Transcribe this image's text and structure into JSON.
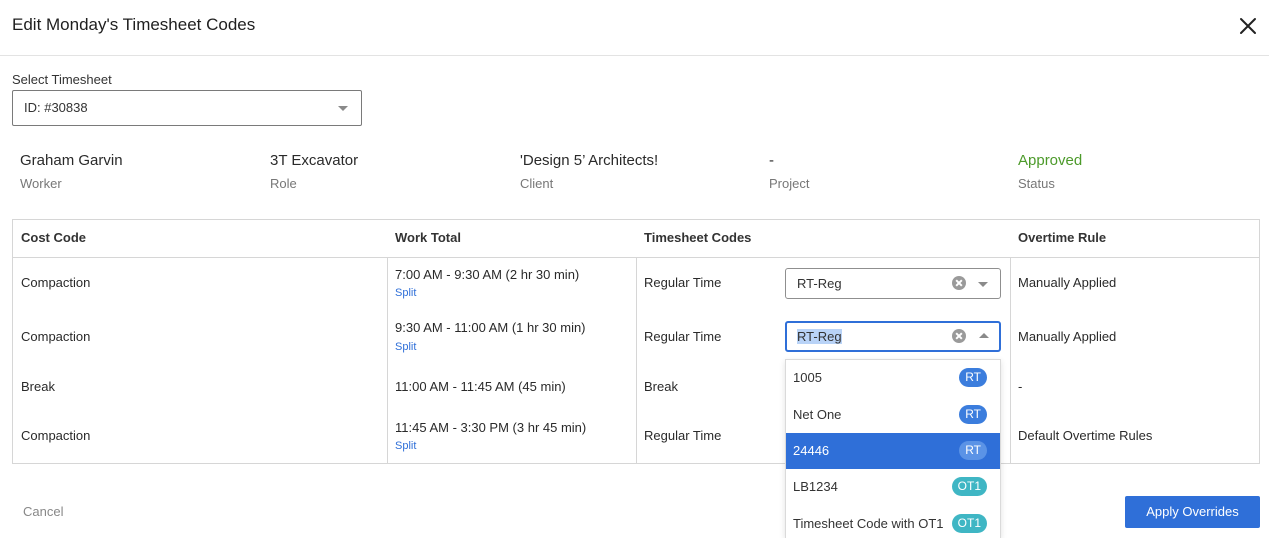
{
  "header": {
    "title": "Edit Monday's Timesheet Codes"
  },
  "timesheet_select": {
    "label": "Select Timesheet",
    "value": "ID: #30838"
  },
  "info": [
    {
      "value": "Graham Garvin",
      "label": "Worker"
    },
    {
      "value": "3T Excavator",
      "label": "Role"
    },
    {
      "value": "'Design 5’ Architects!",
      "label": "Client"
    },
    {
      "value": "-",
      "label": "Project"
    },
    {
      "value": "Approved",
      "label": "Status"
    }
  ],
  "status_color": "#4c9a2a",
  "table": {
    "headers": [
      "Cost Code",
      "Work Total",
      "Timesheet Codes",
      "Overtime Rule"
    ],
    "rows": [
      {
        "cost_code": "Compaction",
        "work_total": "7:00 AM - 9:30 AM (2 hr 30 min)",
        "split": "Split",
        "code_type": "Regular Time",
        "code_value": "RT-Reg",
        "overtime_rule": "Manually Applied"
      },
      {
        "cost_code": "Compaction",
        "work_total": "9:30 AM - 11:00 AM (1 hr 30 min)",
        "split": "Split",
        "code_type": "Regular Time",
        "code_value": "RT-Reg",
        "overtime_rule": "Manually Applied"
      },
      {
        "cost_code": "Break",
        "work_total": "11:00 AM - 11:45 AM (45 min)",
        "code_type": "Break",
        "overtime_rule": "-"
      },
      {
        "cost_code": "Compaction",
        "work_total": "11:45 AM - 3:30 PM (3 hr 45 min)",
        "split": "Split",
        "code_type": "Regular Time",
        "overtime_rule": "Default Overtime Rules"
      }
    ]
  },
  "dropdown": {
    "options": [
      {
        "label": "1005",
        "badge": "RT"
      },
      {
        "label": "Net One",
        "badge": "RT"
      },
      {
        "label": "24446",
        "badge": "RT",
        "selected": true
      },
      {
        "label": "LB1234",
        "badge": "OT1"
      },
      {
        "label": "Timesheet Code with OT1",
        "badge": "OT1"
      }
    ]
  },
  "footer": {
    "cancel_label": "Cancel",
    "apply_label": "Apply Overrides"
  },
  "colors": {
    "accent": "#2f6fd8",
    "badge_rt": "#3b7ddd",
    "badge_ot": "#3fb6c4"
  },
  "icons": {
    "close": "close-icon",
    "clear": "clear-circle-icon",
    "caret": "chevron-down-icon"
  }
}
